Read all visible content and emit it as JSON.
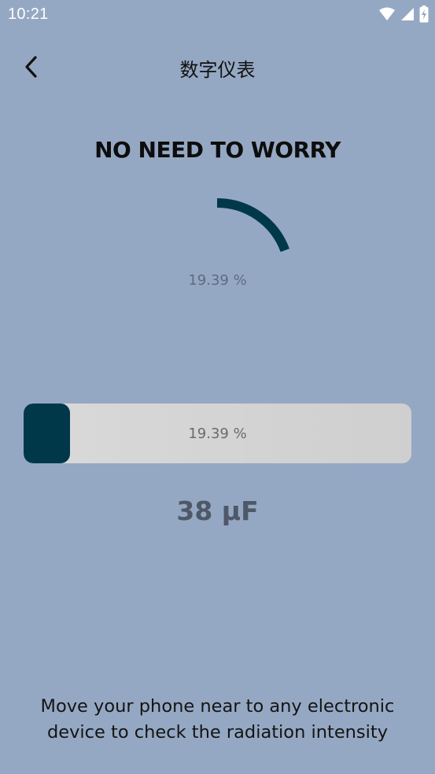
{
  "status_bar": {
    "time": "10:21",
    "icons": [
      "wifi-icon",
      "signal-icon",
      "battery-charging-icon"
    ]
  },
  "app_bar": {
    "title": "数字仪表",
    "back_icon": "chevron-left-icon"
  },
  "meter": {
    "headline": "NO NEED TO WORRY",
    "gauge_percent_label": "19.39 %",
    "level_fraction": 0.1939,
    "progress_label": "19.39 %",
    "reading": "38 µF"
  },
  "instructions": "Move your phone near to any electronic device to check the radiation intensity",
  "colors": {
    "background": "#95a8c3",
    "accent": "#00384a",
    "track": "#d4d4d4"
  }
}
